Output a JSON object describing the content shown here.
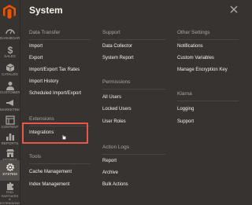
{
  "sidebar": {
    "items": [
      {
        "label": "DASHBOARD",
        "icon": "dashboard-icon"
      },
      {
        "label": "SALES",
        "icon": "dollar-icon"
      },
      {
        "label": "CATALOG",
        "icon": "box-icon"
      },
      {
        "label": "CUSTOMERS",
        "icon": "person-icon"
      },
      {
        "label": "MARKETING",
        "icon": "megaphone-icon"
      },
      {
        "label": "CONTENT",
        "icon": "layout-icon"
      },
      {
        "label": "REPORTS",
        "icon": "bar-chart-icon"
      },
      {
        "label": "STORES",
        "icon": "store-icon"
      },
      {
        "label": "SYSTEM",
        "icon": "gear-icon"
      },
      {
        "label": "FIND PARTNERS & EXTENSIONS",
        "icon": "puzzle-icon"
      }
    ]
  },
  "panel": {
    "title": "System",
    "columns": [
      {
        "sections": [
          {
            "title": "Data Transfer",
            "links": [
              "Import",
              "Export",
              "Import/Export Tax Rates",
              "Import History",
              "Scheduled Import/Export"
            ]
          },
          {
            "title": "Extensions",
            "links": [
              "Integrations"
            ]
          },
          {
            "title": "Tools",
            "links": [
              "Cache Management",
              "Index Management"
            ]
          }
        ]
      },
      {
        "sections": [
          {
            "title": "Support",
            "links": [
              "Data Collector",
              "System Report"
            ]
          },
          {
            "title": "Permissions",
            "links": [
              "All Users",
              "Locked Users",
              "User Roles"
            ]
          },
          {
            "title": "Action Logs",
            "links": [
              "Report",
              "Archive",
              "Bulk Actions"
            ]
          }
        ]
      },
      {
        "sections": [
          {
            "title": "Other Settings",
            "links": [
              "Notifications",
              "Custom Variables",
              "Manage Encryption Key"
            ]
          },
          {
            "title": "Klarna",
            "links": [
              "Logging",
              "Support"
            ]
          }
        ]
      }
    ]
  },
  "colors": {
    "panel_bg": "#373330",
    "text_primary": "#f7f3eb",
    "text_muted": "#aaa6a0",
    "highlight": "#e7584a",
    "logo": "#eb5202"
  }
}
